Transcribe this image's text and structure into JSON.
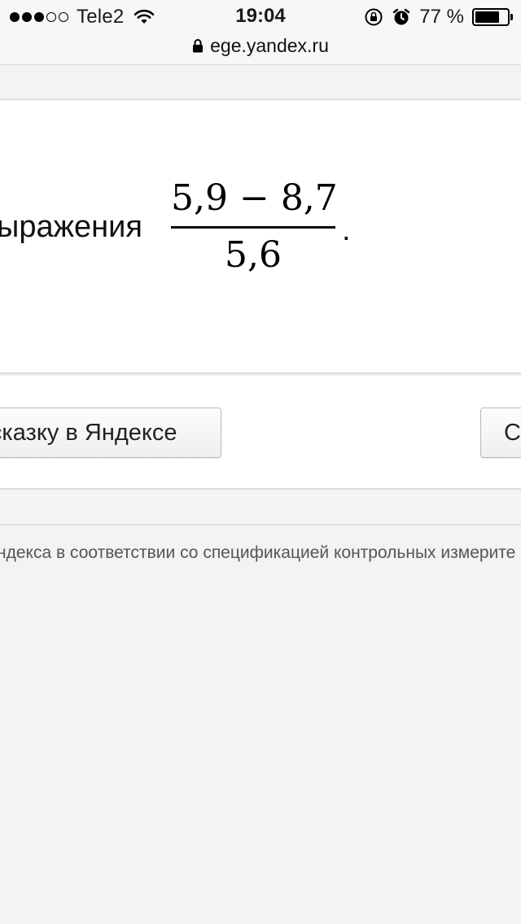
{
  "status_bar": {
    "carrier": "Tele2",
    "time": "19:04",
    "battery_percent": "77 %",
    "battery_level": 0.77,
    "signal_bars_filled": 3,
    "signal_bars_total": 5,
    "icons": [
      "wifi-icon",
      "rotation-lock-icon",
      "alarm-icon",
      "battery-icon"
    ]
  },
  "url_bar": {
    "domain": "ege.yandex.ru",
    "icon": "lock-icon"
  },
  "task": {
    "text": "ыражения",
    "fraction": {
      "numerator": "5,9 − 8,7",
      "denominator": "5,6"
    },
    "period": "."
  },
  "actions": {
    "hint_button": "дсказку в Яндексе",
    "check_button": "С"
  },
  "footer": {
    "note": "ндекса в соответствии со спецификацией контрольных измерите"
  }
}
